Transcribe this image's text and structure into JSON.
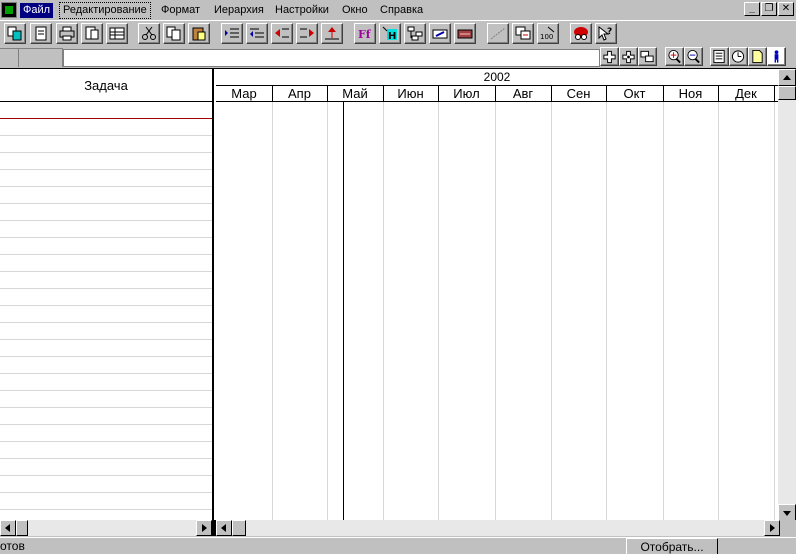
{
  "menu": {
    "items": [
      {
        "label": "Файл"
      },
      {
        "label": "Редактирование"
      },
      {
        "label": "Формат"
      },
      {
        "label": "Иерархия"
      },
      {
        "label": "Настройки"
      },
      {
        "label": "Окно"
      },
      {
        "label": "Справка"
      }
    ],
    "window_controls": {
      "minimize": "_",
      "restore": "❐",
      "close": "✕"
    }
  },
  "toolbar1": {
    "buttons": [
      "copy-view",
      "new-doc",
      "print",
      "print-preview",
      "export",
      "cut",
      "copy",
      "paste",
      "indent",
      "outdent",
      "move-left",
      "move-right",
      "move-up",
      "font",
      "highlight",
      "link",
      "edit",
      "color-palette",
      "progress",
      "copy-schedule",
      "percent-100",
      "assistant",
      "context-help"
    ]
  },
  "toolbar2": {
    "buttons": [
      "add",
      "move",
      "link-tasks",
      "zoom-in",
      "zoom-out",
      "notes",
      "clock",
      "page",
      "person"
    ]
  },
  "task_pane": {
    "header": "Задача",
    "row_count": 24
  },
  "timeline": {
    "year": "2002",
    "months": [
      "Мар",
      "Апр",
      "Май",
      "Июн",
      "Июл",
      "Авг",
      "Сен",
      "Окт",
      "Ноя",
      "Дек"
    ]
  },
  "statusbar": {
    "text": "отов",
    "show_button": "Отобрать..."
  },
  "colors": {
    "window": "#c0c0c0",
    "selection": "#000080",
    "current_row_line": "#a00000",
    "gridline": "#d8d8d8"
  }
}
